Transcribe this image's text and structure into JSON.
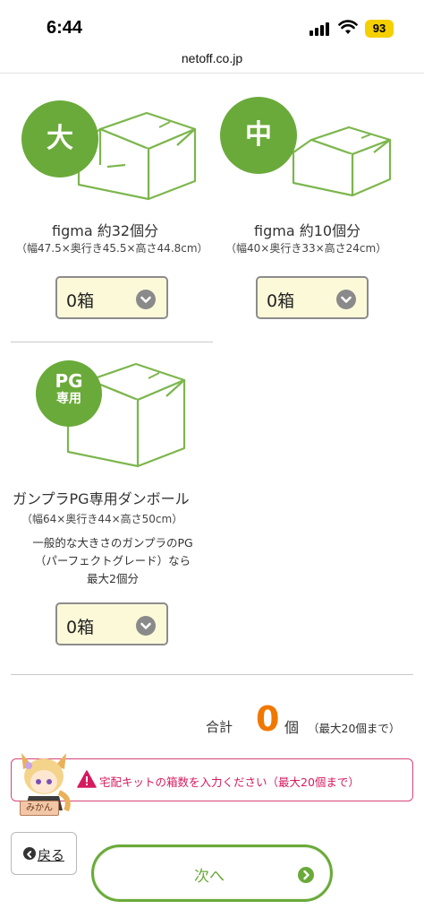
{
  "status_bar": {
    "time": "6:44",
    "battery": "93"
  },
  "browser": {
    "url": "netoff.co.jp"
  },
  "boxes": {
    "large": {
      "badge": "大",
      "title": "figma 約32個分",
      "dims": "（幅47.5×奥行き45.5×高さ44.8cm）",
      "selected": "0箱"
    },
    "medium": {
      "badge": "中",
      "title": "figma 約10個分",
      "dims": "（幅40×奥行き33×高さ24cm）",
      "selected": "0箱"
    },
    "pg": {
      "badge_line1": "PG",
      "badge_line2": "専用",
      "title": "ガンプラPG専用ダンボール",
      "dims": "（幅64×奥行き44×高さ50cm）",
      "desc_line1": "一般的な大きさのガンプラのPG",
      "desc_line2": "（パーフェクトグレード）なら",
      "desc_line3": "最大2個分",
      "selected": "0箱"
    }
  },
  "total": {
    "label": "合計",
    "count": "0",
    "unit": "個",
    "max_note": "（最大20個まで）"
  },
  "alert": {
    "message": "宅配キットの箱数を入力ください（最大20個まで）"
  },
  "mascot": {
    "tag": "みかん"
  },
  "nav": {
    "back_label": "戻る",
    "next_label": "次へ"
  },
  "colors": {
    "accent_green": "#6aaa3a",
    "total_orange": "#f07800",
    "alert_pink": "#d61a5e"
  },
  "icons": [
    "signal-icon",
    "wifi-icon",
    "box-icon",
    "chevron-down-icon",
    "warning-icon",
    "chevron-left-icon",
    "chevron-right-icon"
  ]
}
